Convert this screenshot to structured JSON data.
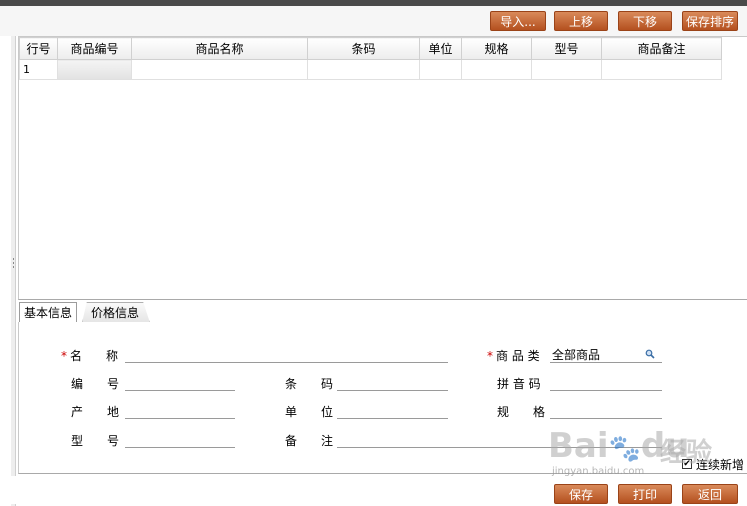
{
  "toolbar": {
    "import_label": "导入...",
    "up_label": "上移",
    "down_label": "下移",
    "save_sort_label": "保存排序"
  },
  "grid": {
    "columns": [
      "行号",
      "商品编号",
      "商品名称",
      "条码",
      "单位",
      "规格",
      "型号",
      "商品备注"
    ],
    "rows": [
      {
        "row_no": "1",
        "code": "",
        "name": "",
        "barcode": "",
        "unit": "",
        "spec": "",
        "model": "",
        "remark": ""
      }
    ]
  },
  "tabs": {
    "basic": "基本信息",
    "price": "价格信息"
  },
  "form": {
    "name_label": "名　　称",
    "category_label": "商 品 类",
    "category_value": "全部商品",
    "code_label": "编　　号",
    "barcode_label": "条　　码",
    "pinyin_label": "拼 音 码",
    "origin_label": "产　　地",
    "unit_label": "单　　位",
    "spec_label": "规　　格",
    "model_label": "型　　号",
    "remark_label": "备　　注",
    "required_mark": "*",
    "continuous_add_label": "连续新增",
    "continuous_add_checked": true
  },
  "footer": {
    "save_label": "保存",
    "print_label": "打印",
    "back_label": "返回"
  },
  "watermark": {
    "brand": "Bai",
    "brand2": "du",
    "suffix": "经验",
    "url": "jingyan.baidu.com"
  },
  "colors": {
    "button_top": "#d98a5a",
    "button_bottom": "#b4501f",
    "required": "#cc0000"
  }
}
